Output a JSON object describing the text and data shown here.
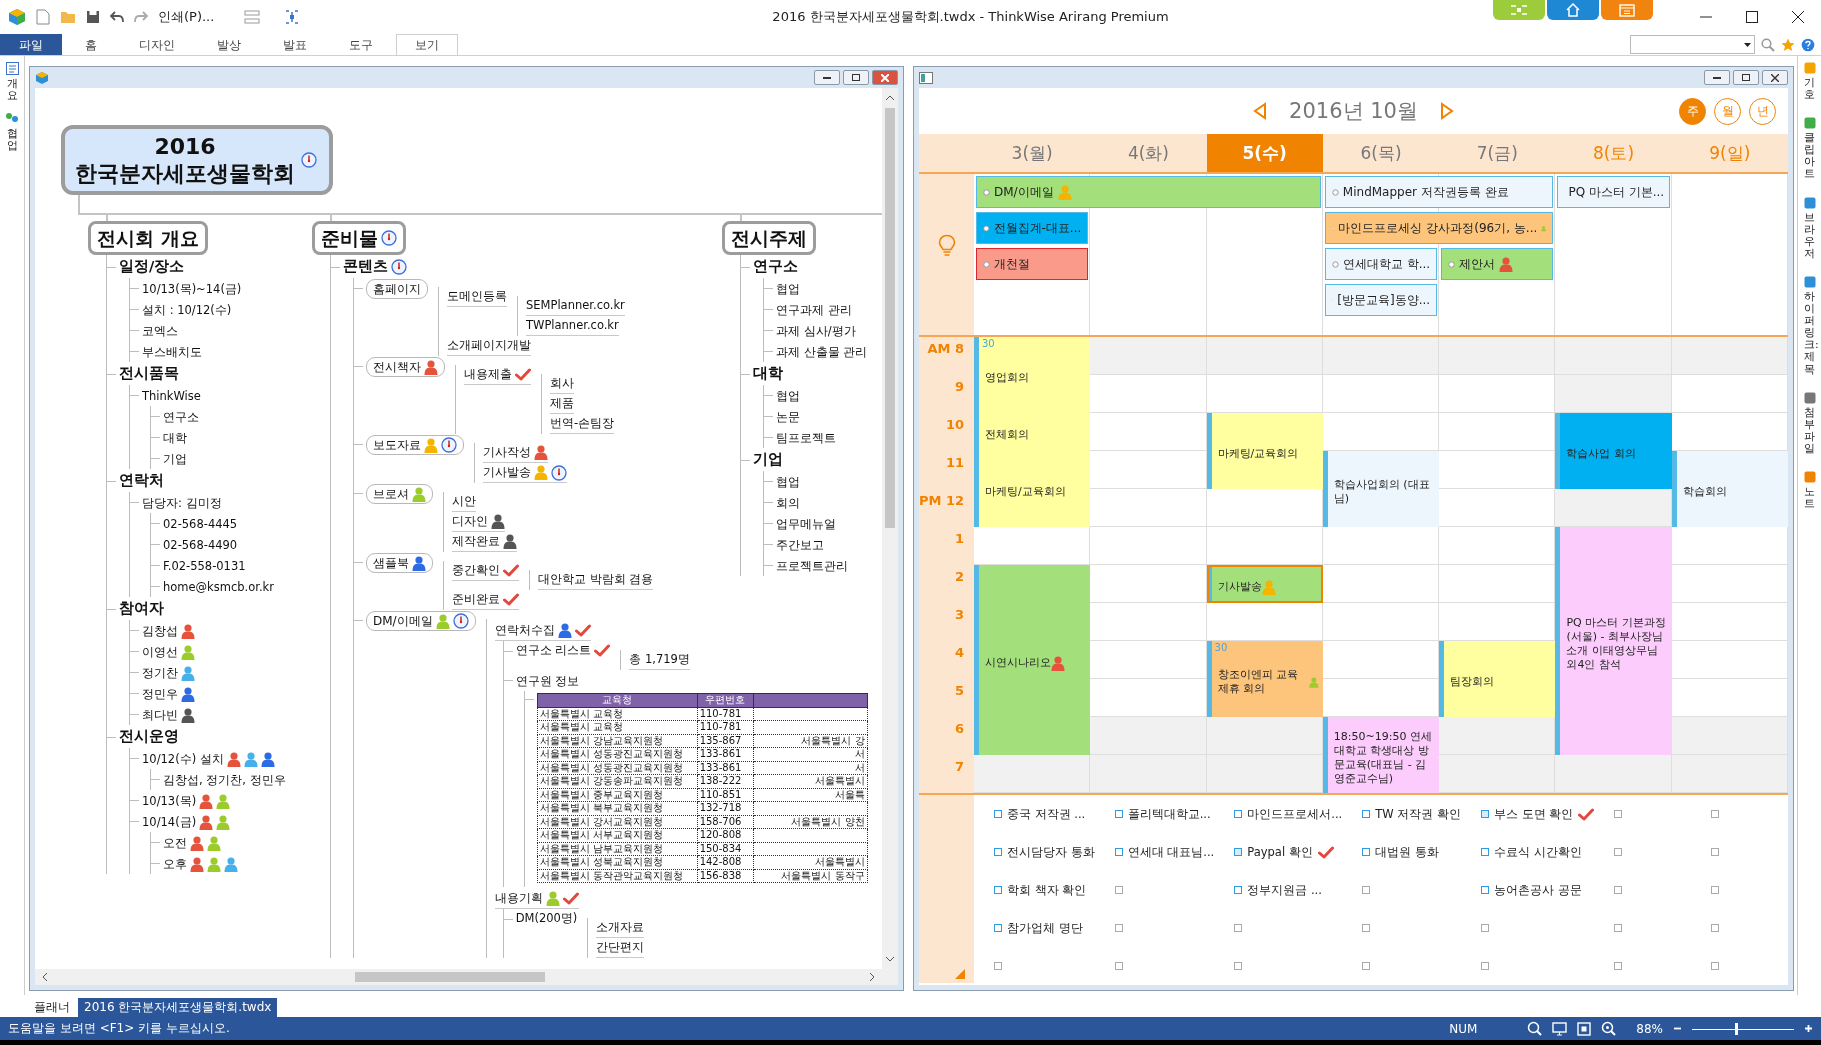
{
  "window": {
    "title": "2016 한국분자세포생물학회.twdx - ThinkWise Arirang Premium"
  },
  "toolbar": {
    "print": "인쇄(P)..."
  },
  "ribbon_tabs": [
    {
      "label": "파일",
      "kind": "file",
      "selected": false
    },
    {
      "label": "홈",
      "kind": "tab",
      "selected": false
    },
    {
      "label": "디자인",
      "kind": "tab",
      "selected": false
    },
    {
      "label": "발상",
      "kind": "tab",
      "selected": false
    },
    {
      "label": "발표",
      "kind": "tab",
      "selected": false
    },
    {
      "label": "도구",
      "kind": "tab",
      "selected": false
    },
    {
      "label": "보기",
      "kind": "tab",
      "selected": true
    }
  ],
  "left_panel": [
    {
      "label": "개요"
    },
    {
      "label": "협업"
    }
  ],
  "right_panel": [
    {
      "label": "기호"
    },
    {
      "label": "클립아트"
    },
    {
      "label": "브라우저"
    },
    {
      "label": "하이퍼링크: 제목"
    },
    {
      "label": "첨부파일"
    },
    {
      "label": "노트"
    }
  ],
  "mindmap": {
    "root": {
      "lines": [
        "2016",
        "한국분자세포생물학회"
      ],
      "marks": [
        {
          "kind": "clock"
        }
      ]
    },
    "topics": [
      {
        "label": "전시회 개요",
        "kind": "topic",
        "children": [
          {
            "label": "일정/장소",
            "kind": "heading",
            "children": [
              {
                "label": "10/13(목)~14(금)",
                "kind": "item"
              },
              {
                "label": "설치 : 10/12(수)",
                "kind": "item"
              },
              {
                "label": "코엑스",
                "kind": "item"
              },
              {
                "label": "부스배치도",
                "kind": "item"
              }
            ]
          },
          {
            "label": "전시품목",
            "kind": "heading",
            "children": [
              {
                "label": "ThinkWise",
                "kind": "item",
                "children": [
                  {
                    "label": "연구소",
                    "kind": "item"
                  },
                  {
                    "label": "대학",
                    "kind": "item"
                  },
                  {
                    "label": "기업",
                    "kind": "item"
                  }
                ]
              }
            ]
          },
          {
            "label": "연락처",
            "kind": "heading",
            "children": [
              {
                "label": "담당자:  김미정",
                "kind": "item",
                "children": [
                  {
                    "label": "02-568-4445",
                    "kind": "item"
                  },
                  {
                    "label": "02-568-4490",
                    "kind": "item"
                  },
                  {
                    "label": "F.02-558-0131",
                    "kind": "item"
                  },
                  {
                    "label": "home@ksmcb.or.kr",
                    "kind": "item"
                  }
                ]
              }
            ]
          },
          {
            "label": "참여자",
            "kind": "heading",
            "children": [
              {
                "label": "김창섭",
                "kind": "item",
                "marks": [
                  {
                    "kind": "person",
                    "color": "#e5533c"
                  }
                ]
              },
              {
                "label": "이영선",
                "kind": "item",
                "marks": [
                  {
                    "kind": "person",
                    "color": "#9ccc2c"
                  }
                ]
              },
              {
                "label": "정기찬",
                "kind": "item",
                "marks": [
                  {
                    "kind": "person",
                    "color": "#45b0ea"
                  }
                ]
              },
              {
                "label": "정민우",
                "kind": "item",
                "marks": [
                  {
                    "kind": "person",
                    "color": "#2d6be4"
                  }
                ]
              },
              {
                "label": "최다빈",
                "kind": "item",
                "marks": [
                  {
                    "kind": "person",
                    "color": "#555555"
                  }
                ]
              }
            ]
          },
          {
            "label": "전시운영",
            "kind": "heading",
            "children": [
              {
                "label": "10/12(수)  설치",
                "kind": "item",
                "marks": [
                  {
                    "kind": "person",
                    "color": "#e5533c"
                  },
                  {
                    "kind": "person",
                    "color": "#45b0ea"
                  },
                  {
                    "kind": "person",
                    "color": "#2d6be4"
                  }
                ],
                "children": [
                  {
                    "label": "김창섭,  정기찬,  정민우",
                    "kind": "item"
                  }
                ]
              },
              {
                "label": "10/13(목)",
                "kind": "item",
                "marks": [
                  {
                    "kind": "person",
                    "color": "#e5533c"
                  },
                  {
                    "kind": "person",
                    "color": "#9ccc2c"
                  }
                ]
              },
              {
                "label": "10/14(금)",
                "kind": "item",
                "marks": [
                  {
                    "kind": "person",
                    "color": "#e5533c"
                  },
                  {
                    "kind": "person",
                    "color": "#9ccc2c"
                  }
                ],
                "children": [
                  {
                    "label": "오전",
                    "kind": "item",
                    "marks": [
                      {
                        "kind": "person",
                        "color": "#e5533c"
                      },
                      {
                        "kind": "person",
                        "color": "#9ccc2c"
                      }
                    ]
                  },
                  {
                    "label": "오후",
                    "kind": "item",
                    "marks": [
                      {
                        "kind": "person",
                        "color": "#e5533c"
                      },
                      {
                        "kind": "person",
                        "color": "#9ccc2c"
                      },
                      {
                        "kind": "person",
                        "color": "#45b0ea"
                      }
                    ]
                  }
                ]
              }
            ]
          }
        ]
      },
      {
        "label": "준비물",
        "kind": "topic",
        "marks": [
          {
            "kind": "clock"
          }
        ],
        "children": [
          {
            "label": "콘텐츠",
            "kind": "heading",
            "marks": [
              {
                "kind": "clock"
              }
            ],
            "children": [
              {
                "label": "홈페이지",
                "kind": "pill",
                "children": [
                  {
                    "label": "도메인등록",
                    "kind": "item",
                    "children": [
                      {
                        "label": "SEMPlanner.co.kr",
                        "kind": "item"
                      },
                      {
                        "label": "TWPlanner.co.kr",
                        "kind": "item"
                      }
                    ]
                  },
                  {
                    "label": "소개페이지개발",
                    "kind": "item"
                  }
                ]
              },
              {
                "label": "전시책자",
                "kind": "pill",
                "marks": [
                  {
                    "kind": "person",
                    "color": "#e5533c"
                  }
                ],
                "children": [
                  {
                    "label": "내용제출",
                    "kind": "item",
                    "marks": [
                      {
                        "kind": "check"
                      }
                    ],
                    "children": [
                      {
                        "label": "회사",
                        "kind": "item"
                      },
                      {
                        "label": "제품",
                        "kind": "item"
                      },
                      {
                        "label": "번역-손팀장",
                        "kind": "item"
                      }
                    ]
                  }
                ]
              },
              {
                "label": "보도자료",
                "kind": "pill",
                "marks": [
                  {
                    "kind": "person",
                    "color": "#f4b400"
                  },
                  {
                    "kind": "clock"
                  }
                ],
                "children": [
                  {
                    "label": "기사작성",
                    "kind": "item",
                    "marks": [
                      {
                        "kind": "person",
                        "color": "#e5533c"
                      }
                    ]
                  },
                  {
                    "label": "기사발송",
                    "kind": "item",
                    "marks": [
                      {
                        "kind": "person",
                        "color": "#f4b400"
                      },
                      {
                        "kind": "clock"
                      }
                    ]
                  }
                ]
              },
              {
                "label": "브로셔",
                "kind": "pill",
                "marks": [
                  {
                    "kind": "person",
                    "color": "#9ccc2c"
                  }
                ],
                "children": [
                  {
                    "label": "시안",
                    "kind": "item"
                  },
                  {
                    "label": "디자인",
                    "kind": "item",
                    "marks": [
                      {
                        "kind": "person",
                        "color": "#555555"
                      }
                    ]
                  },
                  {
                    "label": "제작완료",
                    "kind": "item",
                    "marks": [
                      {
                        "kind": "person",
                        "color": "#555555"
                      }
                    ]
                  }
                ]
              },
              {
                "label": "샘플북",
                "kind": "pill",
                "marks": [
                  {
                    "kind": "person",
                    "color": "#2d6be4"
                  }
                ],
                "children": [
                  {
                    "label": "중간확인",
                    "kind": "item",
                    "marks": [
                      {
                        "kind": "check"
                      }
                    ],
                    "children": [
                      {
                        "label": "대안학교  박람회  겸용",
                        "kind": "item"
                      }
                    ]
                  },
                  {
                    "label": "준비완료",
                    "kind": "item",
                    "marks": [
                      {
                        "kind": "check"
                      }
                    ]
                  }
                ]
              },
              {
                "label": "DM/이메일",
                "kind": "pill",
                "marks": [
                  {
                    "kind": "person",
                    "color": "#9ccc2c"
                  },
                  {
                    "kind": "clock"
                  }
                ],
                "children": [
                  {
                    "label": "연락처수집",
                    "kind": "item",
                    "marks": [
                      {
                        "kind": "person",
                        "color": "#2d6be4"
                      },
                      {
                        "kind": "check"
                      }
                    ],
                    "children": [
                      {
                        "label": "연구소  리스트",
                        "kind": "item",
                        "marks": [
                          {
                            "kind": "check"
                          }
                        ],
                        "children": [
                          {
                            "label": "총  1,719명",
                            "kind": "item"
                          }
                        ]
                      },
                      {
                        "label": "연구원  정보",
                        "kind": "item",
                        "children": [
                          {
                            "kind": "table",
                            "columns": [
                              "교육청",
                              "우편번호"
                            ],
                            "rows": [
                              {
                                "cells": [
                                  "서울특별시 교육청",
                                  "110-781"
                                ]
                              },
                              {
                                "cells": [
                                  "서울특별시 교육청",
                                  "110-781"
                                ]
                              },
                              {
                                "cells": [
                                  "서울특별시 강남교육지원청",
                                  "135-867",
                                  "서울특별시 강"
                                ]
                              },
                              {
                                "cells": [
                                  "서울특별시 성동광진교육지원청",
                                  "133-861",
                                  "서"
                                ]
                              },
                              {
                                "cells": [
                                  "서울특별시 성동광진교육지원청",
                                  "133-861",
                                  "서"
                                ]
                              },
                              {
                                "cells": [
                                  "서울특별시 강동송파교육지원청",
                                  "138-222",
                                  "서울특별시"
                                ]
                              },
                              {
                                "cells": [
                                  "서울특별시 중부교육지원청",
                                  "110-851",
                                  "서울특"
                                ]
                              },
                              {
                                "cells": [
                                  "서울특별시 북부교육지원청",
                                  "132-718"
                                ]
                              },
                              {
                                "cells": [
                                  "서울특별시 강서교육지원청",
                                  "158-706",
                                  "서울특별시 양천"
                                ]
                              },
                              {
                                "cells": [
                                  "서울특별시 서부교육지원청",
                                  "120-808"
                                ]
                              },
                              {
                                "cells": [
                                  "서울특별시 남부교육지원청",
                                  "150-834"
                                ]
                              },
                              {
                                "cells": [
                                  "서울특별시 성북교육지원청",
                                  "142-808",
                                  "서울특별시"
                                ]
                              },
                              {
                                "cells": [
                                  "서울특별시 동작관악교육지원청",
                                  "156-838",
                                  "서울특별시 동작구"
                                ]
                              }
                            ]
                          }
                        ]
                      }
                    ]
                  },
                  {
                    "label": "내용기획",
                    "kind": "item",
                    "marks": [
                      {
                        "kind": "person",
                        "color": "#9ccc2c"
                      },
                      {
                        "kind": "check"
                      }
                    ],
                    "children": [
                      {
                        "label": "DM(200명)",
                        "kind": "item",
                        "children": [
                          {
                            "label": "소개자료",
                            "kind": "item"
                          },
                          {
                            "label": "간단편지",
                            "kind": "item"
                          }
                        ]
                      }
                    ]
                  }
                ]
              }
            ]
          }
        ]
      },
      {
        "label": "전시주제",
        "kind": "topic",
        "children": [
          {
            "label": "연구소",
            "kind": "heading",
            "children": [
              {
                "label": "협업",
                "kind": "item"
              },
              {
                "label": "연구과제  관리",
                "kind": "item"
              },
              {
                "label": "과제  심사/평가",
                "kind": "item"
              },
              {
                "label": "과제  산출물  관리",
                "kind": "item"
              }
            ]
          },
          {
            "label": "대학",
            "kind": "heading",
            "children": [
              {
                "label": "협업",
                "kind": "item"
              },
              {
                "label": "논문",
                "kind": "item"
              },
              {
                "label": "팀프로젝트",
                "kind": "item"
              }
            ]
          },
          {
            "label": "기업",
            "kind": "heading",
            "children": [
              {
                "label": "협업",
                "kind": "item"
              },
              {
                "label": "회의",
                "kind": "item"
              },
              {
                "label": "업무메뉴얼",
                "kind": "item"
              },
              {
                "label": "주간보고",
                "kind": "item"
              },
              {
                "label": "프로젝트관리",
                "kind": "item"
              }
            ]
          }
        ]
      }
    ]
  },
  "calendar": {
    "month": "2016년 10월",
    "views": [
      {
        "label": "주",
        "selected": true
      },
      {
        "label": "월",
        "selected": false
      },
      {
        "label": "년",
        "selected": false
      }
    ],
    "days": [
      {
        "label": "3(월)",
        "selected": false,
        "weekend": false,
        "tasks": [
          {
            "text": "중국 저작권 ...",
            "checked": false
          },
          {
            "text": "전시담당자 통화",
            "checked": false
          },
          {
            "text": "학회 책자 확인",
            "checked": false
          },
          {
            "text": "참가업체 명단",
            "checked": false
          }
        ]
      },
      {
        "label": "4(화)",
        "selected": false,
        "weekend": false,
        "tasks": [
          {
            "text": "폴리텍대학교...",
            "checked": false
          },
          {
            "text": "연세대 대표님...",
            "checked": false
          }
        ]
      },
      {
        "label": "5(수)",
        "selected": true,
        "weekend": false,
        "tasks": [
          {
            "text": "마인드프로세서...",
            "checked": false
          },
          {
            "text": "Paypal 확인",
            "checked": true
          },
          {
            "text": "정부지원금 ...",
            "checked": false
          }
        ]
      },
      {
        "label": "6(목)",
        "selected": false,
        "weekend": false,
        "tasks": [
          {
            "text": "TW 저작권 확인",
            "checked": false
          },
          {
            "text": "대법원 통화",
            "checked": false
          }
        ]
      },
      {
        "label": "7(금)",
        "selected": false,
        "weekend": false,
        "tasks": [
          {
            "text": "부스 도면 확인",
            "checked": true
          },
          {
            "text": "수료식 시간확인",
            "checked": false
          },
          {
            "text": "농어촌공사 공문",
            "checked": false
          }
        ]
      },
      {
        "label": "8(토)",
        "selected": false,
        "weekend": true
      },
      {
        "label": "9(일)",
        "selected": false,
        "weekend": true
      }
    ],
    "all_day_rows": [
      {
        "cells": [
          {
            "kind": "event",
            "title": "DM/이메일",
            "color": "#a3df7a",
            "marks": [
              {
                "kind": "person",
                "color": "#f4b400"
              }
            ]
          },
          {
            "kind": "cont"
          },
          {
            "kind": "cont"
          },
          {
            "kind": "event",
            "title": "MindMapper 저작권등록 완료",
            "color": "#eef6fd"
          },
          {
            "kind": "cont"
          },
          {
            "kind": "event",
            "title": "PQ 마스터 기본...",
            "color": "#eef6fd"
          }
        ]
      },
      {
        "cells": [
          {
            "kind": "event",
            "title": "전월집계-대표...",
            "color": "#00b0f0"
          },
          {
            "kind": "empty"
          },
          {
            "kind": "empty"
          },
          {
            "kind": "event",
            "title": "마인드프로세싱 강사과정(96기, 농...",
            "color": "#fdc47c",
            "marks": [
              {
                "kind": "person",
                "color": "#9ccc2c"
              }
            ]
          },
          {
            "kind": "cont"
          }
        ]
      },
      {
        "cells": [
          {
            "kind": "event",
            "title": "개천절",
            "color": "#f99a8a"
          },
          {
            "kind": "empty"
          },
          {
            "kind": "empty"
          },
          {
            "kind": "event",
            "title": "연세대학교 학...",
            "color": "#eef6fd"
          },
          {
            "kind": "event",
            "title": "제안서",
            "color": "#a3df7a",
            "marks": [
              {
                "kind": "person",
                "color": "#e5533c"
              }
            ]
          }
        ]
      },
      {
        "cells": [
          {
            "kind": "empty"
          },
          {
            "kind": "empty"
          },
          {
            "kind": "empty"
          },
          {
            "kind": "event",
            "title": "[방문교육]동양...",
            "color": "#eef6fd"
          }
        ]
      }
    ],
    "time_rows": [
      {
        "hour": "AM 8",
        "cells": [
          {
            "kind": "event",
            "title": "영업회의",
            "color": "#ffff9f",
            "note": "30",
            "selected": false
          },
          {
            "kind": "empty"
          },
          {
            "kind": "empty"
          },
          {
            "kind": "empty"
          },
          {
            "kind": "empty"
          },
          {
            "kind": "empty"
          },
          {
            "kind": "empty"
          }
        ]
      },
      {
        "hour": "9",
        "cells": [
          {
            "kind": "cont"
          },
          {
            "kind": "empty"
          },
          {
            "kind": "empty"
          },
          {
            "kind": "empty"
          },
          {
            "kind": "empty"
          },
          {
            "kind": "empty"
          },
          {
            "kind": "empty"
          }
        ]
      },
      {
        "hour": "10",
        "cells": [
          {
            "kind": "event",
            "title": "전체회의",
            "color": "#ffff9f",
            "selected": false
          },
          {
            "kind": "empty"
          },
          {
            "kind": "event",
            "title": "마케팅/교육회의",
            "color": "#ffff9f",
            "selected": false
          },
          {
            "kind": "empty"
          },
          {
            "kind": "empty"
          },
          {
            "kind": "event",
            "title": "학습사업 회의",
            "color": "#00b0f0",
            "selected": false
          },
          {
            "kind": "empty"
          }
        ]
      },
      {
        "hour": "11",
        "cells": [
          {
            "kind": "event",
            "title": "마케팅/교육회의",
            "color": "#ffff9f",
            "selected": false
          },
          {
            "kind": "empty"
          },
          {
            "kind": "cont"
          },
          {
            "kind": "event",
            "title": "학습사업회의 (대표님)",
            "color": "#eef6fd",
            "selected": false
          },
          {
            "kind": "empty"
          },
          {
            "kind": "cont"
          },
          {
            "kind": "event",
            "title": "학습회의",
            "color": "#eef6fd",
            "selected": false
          }
        ]
      },
      {
        "hour": "PM 12",
        "cells": [
          {
            "kind": "cont"
          },
          {
            "kind": "empty"
          },
          {
            "kind": "empty"
          },
          {
            "kind": "cont"
          },
          {
            "kind": "empty"
          },
          {
            "kind": "empty"
          },
          {
            "kind": "cont"
          }
        ]
      },
      {
        "hour": "1",
        "cells": [
          {
            "kind": "empty"
          },
          {
            "kind": "empty"
          },
          {
            "kind": "empty"
          },
          {
            "kind": "empty"
          },
          {
            "kind": "empty"
          },
          {
            "kind": "event",
            "title": "PQ 마스터 기본과정(서울) - 최부사장님 소개 이태영상무님 외4인 참석",
            "color": "#fccdfc",
            "selected": false
          },
          {
            "kind": "empty"
          }
        ]
      },
      {
        "hour": "2",
        "cells": [
          {
            "kind": "event",
            "title": "시연시나리오",
            "color": "#a3df7a",
            "selected": false,
            "marks": [
              {
                "kind": "person",
                "color": "#e5533c"
              }
            ]
          },
          {
            "kind": "empty"
          },
          {
            "kind": "event",
            "title": "기사발송",
            "color": "#a3df7a",
            "selected": true,
            "marks": [
              {
                "kind": "person",
                "color": "#f4b400"
              }
            ]
          },
          {
            "kind": "empty"
          },
          {
            "kind": "empty"
          },
          {
            "kind": "cont"
          },
          {
            "kind": "empty"
          }
        ]
      },
      {
        "hour": "3",
        "cells": [
          {
            "kind": "cont"
          },
          {
            "kind": "empty"
          },
          {
            "kind": "empty"
          },
          {
            "kind": "empty"
          },
          {
            "kind": "empty"
          },
          {
            "kind": "cont"
          },
          {
            "kind": "empty"
          }
        ]
      },
      {
        "hour": "4",
        "cells": [
          {
            "kind": "cont"
          },
          {
            "kind": "empty"
          },
          {
            "kind": "event",
            "title": "창조이엔피 교육 제휴 회의",
            "color": "#fdc47c",
            "note": "30",
            "selected": false,
            "marks": [
              {
                "kind": "person",
                "color": "#9ccc2c"
              }
            ]
          },
          {
            "kind": "empty"
          },
          {
            "kind": "event",
            "title": "팀장회의",
            "color": "#ffff9f",
            "selected": false
          },
          {
            "kind": "cont"
          },
          {
            "kind": "empty"
          }
        ]
      },
      {
        "hour": "5",
        "cells": [
          {
            "kind": "cont"
          },
          {
            "kind": "empty"
          },
          {
            "kind": "cont"
          },
          {
            "kind": "empty"
          },
          {
            "kind": "cont"
          },
          {
            "kind": "cont"
          },
          {
            "kind": "empty"
          }
        ]
      },
      {
        "hour": "6",
        "cells": [
          {
            "kind": "cont"
          },
          {
            "kind": "empty"
          },
          {
            "kind": "empty"
          },
          {
            "kind": "event",
            "title": "18:50~19:50 연세대학교 학생대상 방문교육(대표님 - 김영준교수님)",
            "color": "#fccdfc",
            "selected": false
          },
          {
            "kind": "empty"
          },
          {
            "kind": "cont"
          },
          {
            "kind": "empty"
          }
        ]
      },
      {
        "hour": "7",
        "cells": [
          {
            "kind": "empty"
          },
          {
            "kind": "empty"
          },
          {
            "kind": "empty"
          },
          {
            "kind": "cont"
          },
          {
            "kind": "empty"
          },
          {
            "kind": "empty"
          },
          {
            "kind": "empty"
          }
        ]
      }
    ]
  },
  "doc_tabs": [
    {
      "label": "플래너",
      "selected": false
    },
    {
      "label": "2016 한국분자세포생물학회.twdx",
      "selected": true
    }
  ],
  "status_bar": {
    "help": "도움말을 보려면 <F1> 키를 누르십시오.",
    "num": "NUM",
    "zoom": "88%",
    "zoom_slider": {
      "level": 0.42
    }
  }
}
